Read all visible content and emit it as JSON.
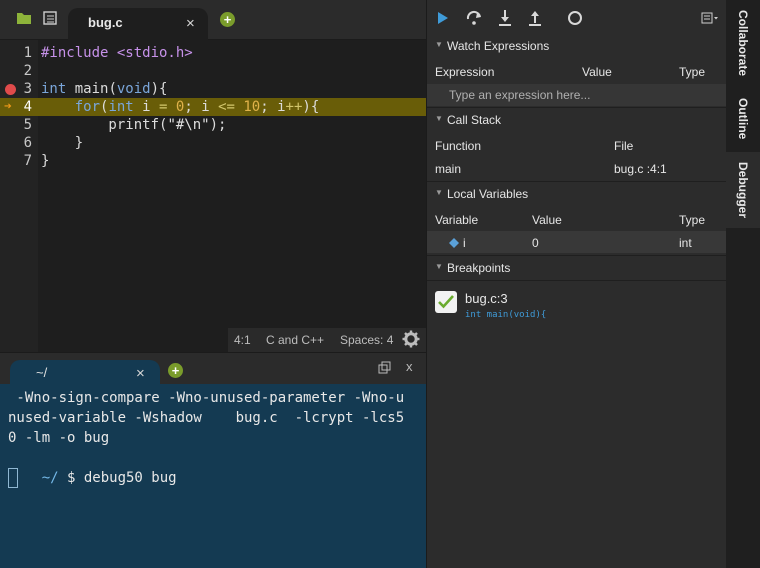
{
  "editor": {
    "tab_label": "bug.c",
    "close_glyph": "×",
    "lines": [
      {
        "num": "1",
        "text": "#include <stdio.h>"
      },
      {
        "num": "2",
        "text": ""
      },
      {
        "num": "3",
        "text": "int main(void){"
      },
      {
        "num": "4",
        "text": "    for(int i = 0; i <= 10; i++){"
      },
      {
        "num": "5",
        "text": "        printf(\"#\\n\");"
      },
      {
        "num": "6",
        "text": "    }"
      },
      {
        "num": "7",
        "text": "}"
      }
    ],
    "breakpoint_line": 3,
    "current_line": 4,
    "status": {
      "cursor": "4:1",
      "language": "C and C++",
      "indent": "Spaces: 4"
    }
  },
  "terminal": {
    "tab_label": "~/",
    "close_glyph": "×",
    "output_lines": [
      " -Wno-sign-compare -Wno-unused-parameter -Wno-u",
      "nused-variable -Wshadow    bug.c  -lcrypt -lcs5",
      "0 -lm -o bug"
    ],
    "prompt_path": "~/",
    "prompt_command": " $ debug50 bug",
    "close_x": "x"
  },
  "debugger": {
    "watch": {
      "title": "Watch Expressions",
      "columns": [
        "Expression",
        "Value",
        "Type"
      ],
      "placeholder": "Type an expression here..."
    },
    "call_stack": {
      "title": "Call Stack",
      "columns": [
        "Function",
        "File"
      ],
      "rows": [
        {
          "function": "main",
          "file": "bug.c :4:1"
        }
      ]
    },
    "locals": {
      "title": "Local Variables",
      "columns": [
        "Variable",
        "Value",
        "Type"
      ],
      "rows": [
        {
          "variable": "i",
          "value": "0",
          "type": "int"
        }
      ]
    },
    "breakpoints": {
      "title": "Breakpoints",
      "items": [
        {
          "file": "bug.c:3",
          "code": "int main(void){",
          "enabled": true
        }
      ]
    }
  },
  "side_tabs": [
    "Collaborate",
    "Outline",
    "Debugger"
  ],
  "colors": {
    "breakpoint": "#e04b4b",
    "current_line": "#695d08",
    "terminal_bg": "#143a52",
    "accent_blue": "#3f9bd8",
    "add_button": "#7a9c2b"
  }
}
